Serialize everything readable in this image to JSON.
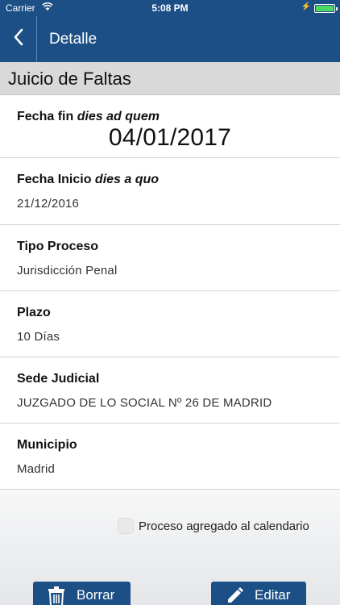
{
  "status_bar": {
    "carrier": "Carrier",
    "time": "5:08 PM"
  },
  "nav": {
    "title": "Detalle"
  },
  "section": {
    "title": "Juicio de Faltas"
  },
  "rows": [
    {
      "label": "Fecha fin",
      "label_italic": "dies ad quem",
      "value": "04/01/2017"
    },
    {
      "label": "Fecha Inicio",
      "label_italic": "dies a quo",
      "value": "21/12/2016"
    },
    {
      "label": "Tipo Proceso",
      "value": "Jurisdicción Penal"
    },
    {
      "label": "Plazo",
      "value": "10 Días"
    },
    {
      "label": "Sede Judicial",
      "value": "JUZGADO DE LO SOCIAL Nº 26 DE MADRID"
    },
    {
      "label": "Municipio",
      "value": "Madrid"
    }
  ],
  "calendar": {
    "label": "Proceso agregado al calendario",
    "checked": false
  },
  "buttons": {
    "delete_label": "Borrar",
    "edit_label": "Editar"
  },
  "colors": {
    "brand": "#1c4f86",
    "battery": "#4cd964"
  },
  "icons": {
    "back": "chevron-left-icon",
    "delete": "trash-icon",
    "edit": "pencil-icon"
  }
}
